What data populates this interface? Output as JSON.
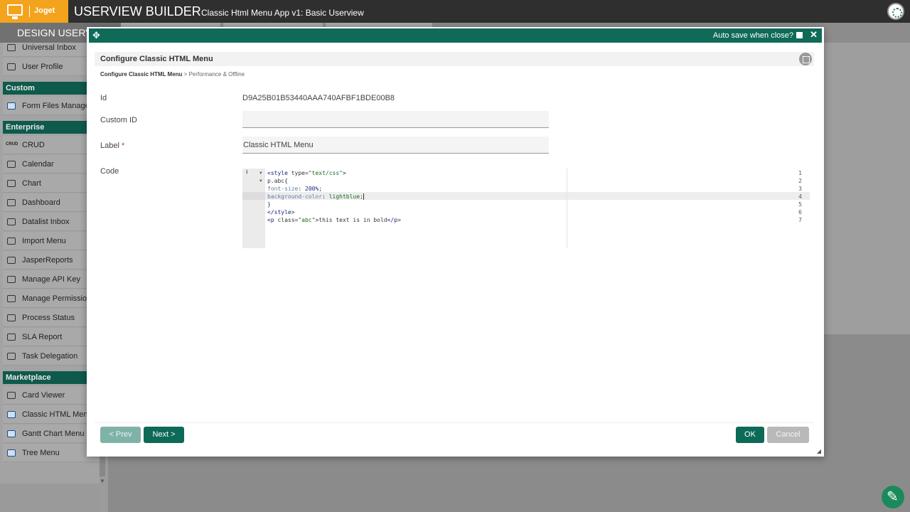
{
  "app": {
    "brand": "Joget",
    "title": "USERVIEW BUILDER",
    "subtitle": "Classic Html Menu App v1: Basic Userview"
  },
  "tabbar": {
    "active_tab": "DESIGN USERVIEW"
  },
  "sidebar": {
    "top_items": [
      {
        "label": "Universal Inbox",
        "icon": "inbox-icon"
      },
      {
        "label": "User Profile",
        "icon": "user-icon"
      }
    ],
    "sections": [
      {
        "title": "Custom",
        "items": [
          {
            "label": "Form Files Manager",
            "icon": "grid-icon"
          }
        ]
      },
      {
        "title": "Enterprise",
        "items": [
          {
            "label": "CRUD",
            "icon": "crud-icon",
            "icon_text": "CRUD"
          },
          {
            "label": "Calendar",
            "icon": "calendar-icon"
          },
          {
            "label": "Chart",
            "icon": "chart-icon"
          },
          {
            "label": "Dashboard",
            "icon": "dashboard-icon"
          },
          {
            "label": "Datalist Inbox",
            "icon": "inbox-icon"
          },
          {
            "label": "Import Menu",
            "icon": "import-icon"
          },
          {
            "label": "JasperReports",
            "icon": "report-icon"
          },
          {
            "label": "Manage API Key",
            "icon": "monitor-icon"
          },
          {
            "label": "Manage Permission",
            "icon": "users-icon"
          },
          {
            "label": "Process Status",
            "icon": "process-icon"
          },
          {
            "label": "SLA Report",
            "icon": "report-icon"
          },
          {
            "label": "Task Delegation",
            "icon": "delegation-icon"
          }
        ]
      },
      {
        "title": "Marketplace",
        "items": [
          {
            "label": "Card Viewer",
            "icon": "monitor-icon"
          },
          {
            "label": "Classic HTML Menu",
            "icon": "grid-icon"
          },
          {
            "label": "Gantt Chart Menu",
            "icon": "grid-icon"
          },
          {
            "label": "Tree Menu",
            "icon": "grid-icon"
          }
        ]
      }
    ]
  },
  "dialog": {
    "autosave_label": "Auto save when close?",
    "autosave_checked": false,
    "header_title": "Configure Classic HTML Menu",
    "breadcrumb": {
      "current": "Configure Classic HTML Menu",
      "separator": ">",
      "next": "Performance & Offline"
    },
    "fields": {
      "id_label": "Id",
      "id_value": "D9A25B01B53440AAA740AFBF1BDE00B8",
      "custom_id_label": "Custom ID",
      "custom_id_value": "",
      "label_label": "Label",
      "label_required": "*",
      "label_value": "Classic HTML Menu",
      "code_label": "Code"
    },
    "code": {
      "active_line": 4,
      "lines": [
        {
          "n": "1",
          "text": "<style type=\"text/css\">"
        },
        {
          "n": "2",
          "text": "p.abc{"
        },
        {
          "n": "3",
          "text": "font-size: 200%;"
        },
        {
          "n": "4",
          "text": "background-color: lightblue;"
        },
        {
          "n": "5",
          "text": "}"
        },
        {
          "n": "6",
          "text": "</style>"
        },
        {
          "n": "7",
          "text": "<p class=\"abc\">this text is in bold</p>"
        }
      ]
    },
    "buttons": {
      "prev": "< Prev",
      "next": "Next >",
      "ok": "OK",
      "cancel": "Cancel"
    }
  },
  "colors": {
    "brand_orange": "#f3a41c",
    "primary_green": "#0d6a57",
    "header_green": "#0f6a58"
  }
}
